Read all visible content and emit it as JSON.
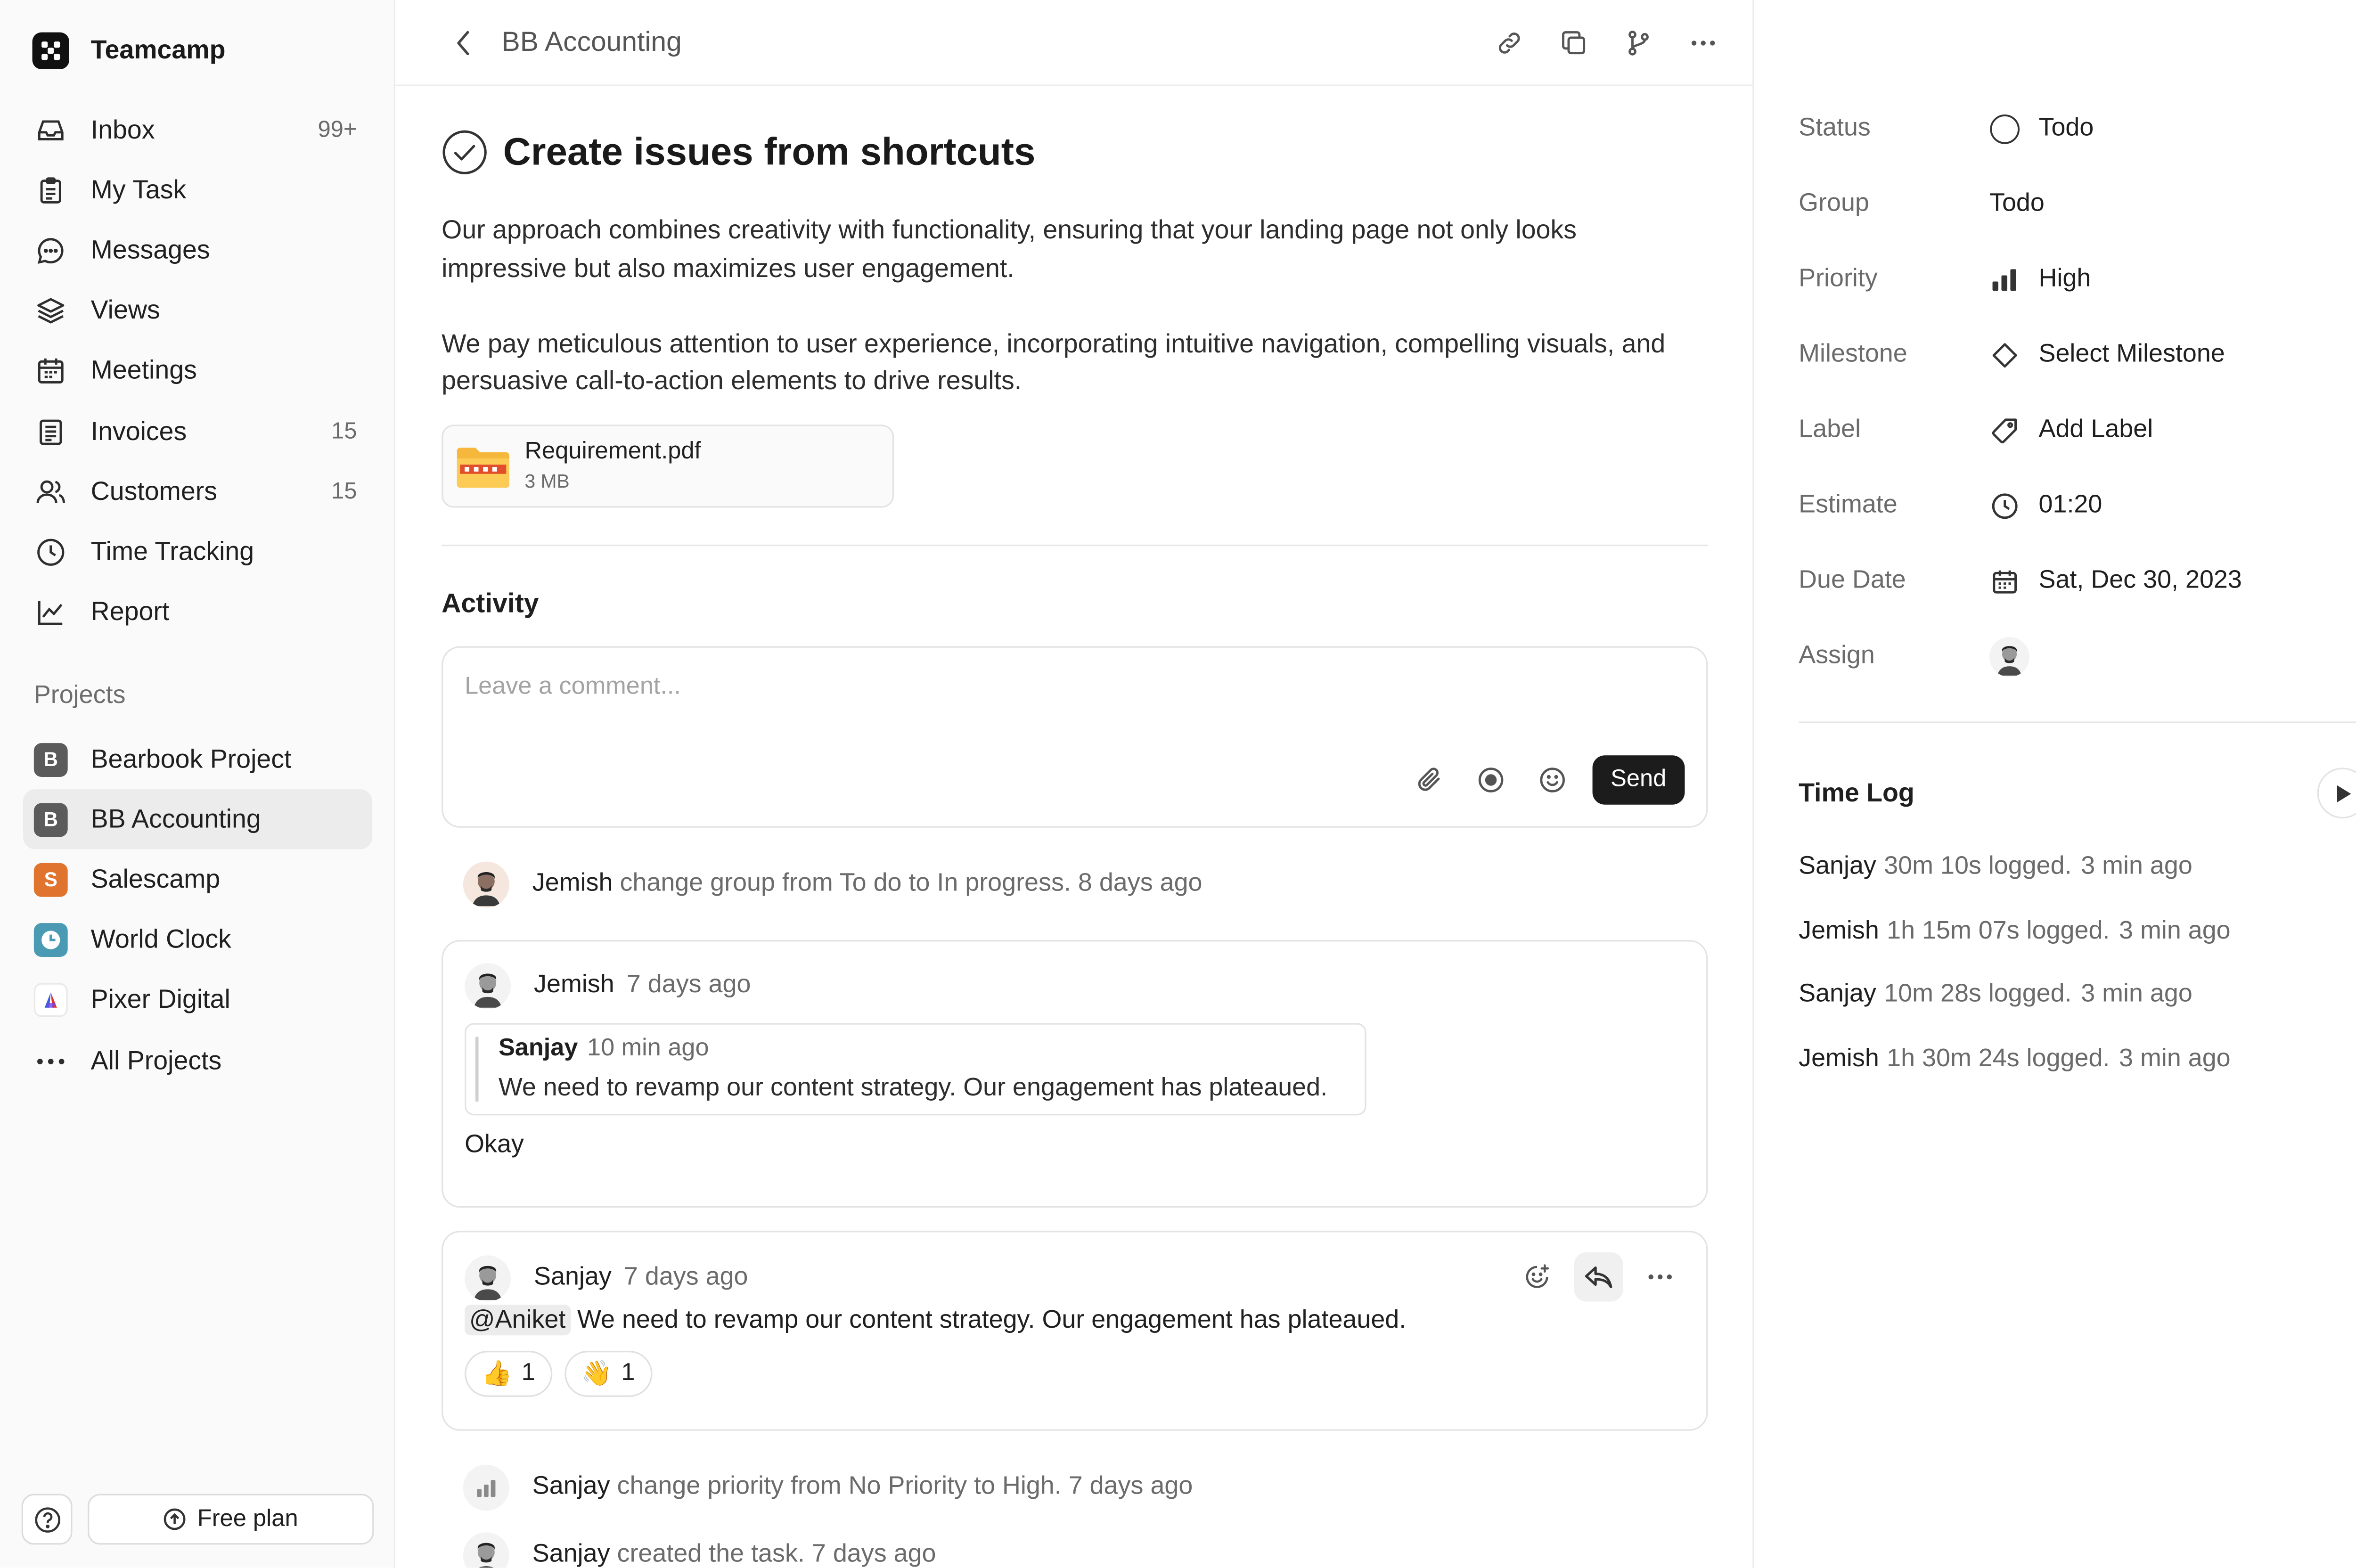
{
  "app": {
    "name": "Teamcamp"
  },
  "sidebar": {
    "items": [
      {
        "label": "Inbox",
        "count": "99+",
        "icon": "inbox-icon"
      },
      {
        "label": "My Task",
        "count": "",
        "icon": "clipboard-icon"
      },
      {
        "label": "Messages",
        "count": "",
        "icon": "chat-bubble-icon"
      },
      {
        "label": "Views",
        "count": "",
        "icon": "layers-icon"
      },
      {
        "label": "Meetings",
        "count": "",
        "icon": "calendar-icon"
      },
      {
        "label": "Invoices",
        "count": "15",
        "icon": "document-icon"
      },
      {
        "label": "Customers",
        "count": "15",
        "icon": "users-icon"
      },
      {
        "label": "Time Tracking",
        "count": "",
        "icon": "clock-icon"
      },
      {
        "label": "Report",
        "count": "",
        "icon": "chart-line-icon"
      }
    ],
    "projects_heading": "Projects",
    "projects": [
      {
        "label": "Bearbook Project",
        "letter": "B",
        "color": "#5b5b5b"
      },
      {
        "label": "BB Accounting",
        "letter": "B",
        "color": "#5b5b5b"
      },
      {
        "label": "Salescamp",
        "letter": "S",
        "color": "#e0742e"
      },
      {
        "label": "World Clock",
        "letter": "",
        "color": "#4b9ab3"
      },
      {
        "label": "Pixer Digital",
        "letter": "",
        "color": "#ffffff"
      },
      {
        "label": "All Projects",
        "letter": "",
        "color": ""
      }
    ],
    "free_plan_label": "Free plan"
  },
  "topbar": {
    "breadcrumb": "BB Accounting"
  },
  "task": {
    "title": "Create issues from shortcuts",
    "description": [
      "Our approach combines creativity with functionality, ensuring that your landing page not only looks impressive but also maximizes user engagement.",
      "We pay meticulous attention to user experience, incorporating intuitive navigation, compelling visuals, and persuasive call-to-action elements to drive results."
    ],
    "attachment": {
      "name": "Requirement.pdf",
      "size": "3 MB"
    }
  },
  "activity": {
    "heading": "Activity",
    "comment_placeholder": "Leave a comment...",
    "send_label": "Send",
    "event1": {
      "who": "Jemish",
      "text": "change group from To do to In progress.",
      "when": "8 days ago"
    },
    "comment1": {
      "who": "Jemish",
      "when": "7 days ago",
      "quote_who": "Sanjay",
      "quote_when": "10 min ago",
      "quote_text": "We need to revamp our content strategy. Our engagement has plateaued.",
      "reply": "Okay"
    },
    "comment2": {
      "who": "Sanjay",
      "when": "7 days ago",
      "mention": "@Aniket",
      "text": "We need to revamp our content strategy. Our engagement has plateaued.",
      "reactions": [
        {
          "emoji": "👍",
          "count": "1"
        },
        {
          "emoji": "👋",
          "count": "1"
        }
      ]
    },
    "event2": {
      "who": "Sanjay",
      "text": "change priority from No Priority to High.",
      "when": "7 days ago"
    },
    "event3": {
      "who": "Sanjay",
      "text": "created the task.",
      "when": "7 days ago"
    }
  },
  "properties": {
    "status": {
      "label": "Status",
      "value": "Todo"
    },
    "group": {
      "label": "Group",
      "value": "Todo"
    },
    "priority": {
      "label": "Priority",
      "value": "High"
    },
    "milestone": {
      "label": "Milestone",
      "value": "Select Milestone"
    },
    "label": {
      "label": "Label",
      "value": "Add Label"
    },
    "estimate": {
      "label": "Estimate",
      "value": "01:20"
    },
    "due_date": {
      "label": "Due Date",
      "value": "Sat, Dec 30, 2023"
    },
    "assign": {
      "label": "Assign"
    }
  },
  "time_log": {
    "heading": "Time Log",
    "entries": [
      {
        "who": "Sanjay",
        "text": "30m 10s logged.",
        "when": "3 min ago"
      },
      {
        "who": "Jemish",
        "text": "1h 15m 07s logged.",
        "when": "3 min ago"
      },
      {
        "who": "Sanjay",
        "text": "10m 28s logged.",
        "when": "3 min ago"
      },
      {
        "who": "Jemish",
        "text": "1h 30m 24s logged.",
        "when": "3 min ago"
      }
    ]
  }
}
